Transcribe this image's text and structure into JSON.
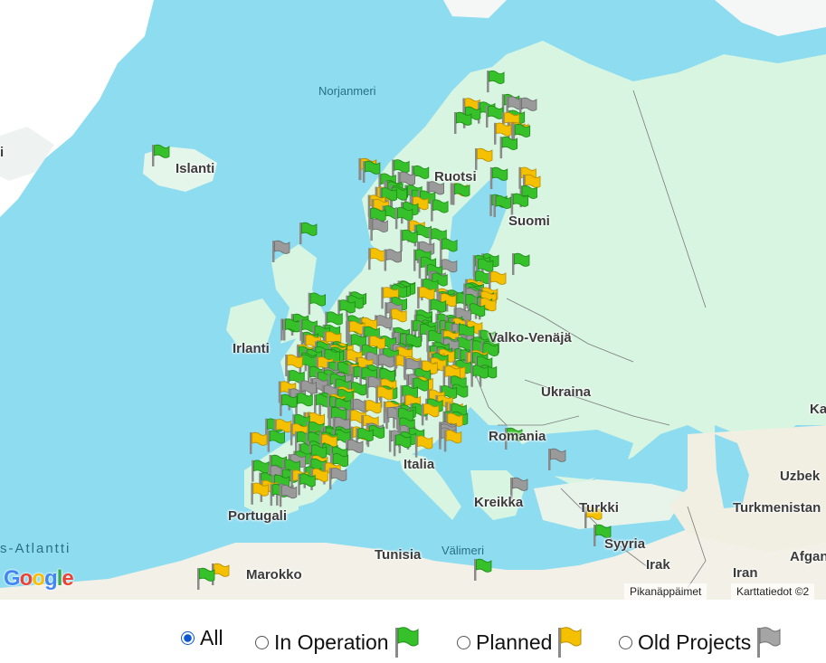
{
  "map": {
    "labels": {
      "norjanmeri": "Norjanmeri",
      "islanti": "Islanti",
      "ruotsi": "Ruotsi",
      "suomi": "Suomi",
      "irlanti": "Irlanti",
      "valko_venaja": "Valko-Venäjä",
      "ukraina": "Ukraina",
      "romania": "Romania",
      "italia": "Italia",
      "portugali": "Portugali",
      "kreikka": "Kreikka",
      "turkki": "Turkki",
      "syyria": "Syyria",
      "irak": "Irak",
      "iran": "Iran",
      "tunisia": "Tunisia",
      "valimeri": "Välimeri",
      "marokko": "Marokko",
      "atlantti": "s-Atlantti",
      "uzbek": "Uzbek",
      "turkmenistan": "Turkmenistan",
      "afgan": "Afgan",
      "ka": "Ka",
      "left_i": "i"
    },
    "attribution": {
      "shortcuts": "Pikanäppäimet",
      "map_data": "Karttatiedot ©2"
    },
    "logo": [
      "G",
      "o",
      "o",
      "g",
      "l",
      "e"
    ],
    "colors": {
      "sea": "#8ddcf0",
      "land": "#d7f5e0",
      "arid": "#f3f1e7",
      "ice": "#ffffff",
      "operation": "#36c02a",
      "planned": "#f5c000",
      "old": "#9a9a9a"
    }
  },
  "filter": {
    "options": [
      {
        "label": "All",
        "selected": true
      },
      {
        "label": "In Operation",
        "flag": "green-flag-icon"
      },
      {
        "label": "Planned",
        "flag": "yellow-flag-icon"
      },
      {
        "label": "Old Projects",
        "flag": "gray-flag-icon"
      }
    ]
  }
}
